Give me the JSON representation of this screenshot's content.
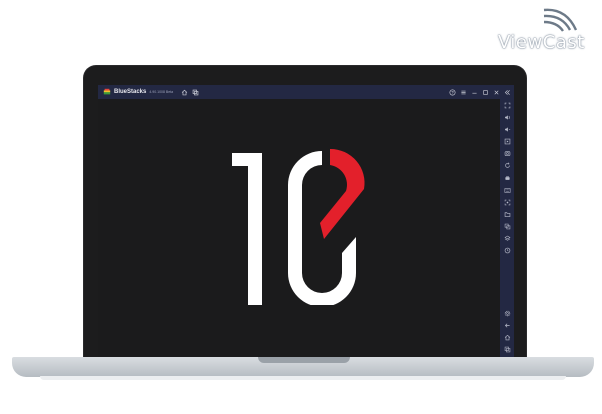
{
  "watermark": {
    "text": "ViewCast"
  },
  "window": {
    "app_name": "BlueStacks",
    "version": "4.90.1008  Beta",
    "title_icons": [
      "home-icon",
      "multi-instance-icon"
    ],
    "controls": [
      "help-icon",
      "menu-icon",
      "minimize-icon",
      "maximize-icon",
      "close-icon",
      "collapse-sidebar-icon"
    ]
  },
  "sidebar": {
    "tools": [
      "fullscreen-icon",
      "volume-up-icon",
      "volume-down-icon",
      "screen-record-icon",
      "screenshot-icon",
      "rotate-icon",
      "shake-icon",
      "keymap-icon",
      "location-icon",
      "folder-icon",
      "copy-icon",
      "layers-icon",
      "macro-icon"
    ],
    "bottom_tools": [
      "settings-icon",
      "back-icon",
      "android-home-icon",
      "recent-apps-icon"
    ]
  },
  "splash": {
    "logo": "10-logo",
    "accent_color": "#e3202b",
    "primary_color": "#ffffff"
  },
  "colors": {
    "titlebar": "#232843",
    "screen": "#1b1b1c",
    "laptop": "#1c1c1d"
  }
}
